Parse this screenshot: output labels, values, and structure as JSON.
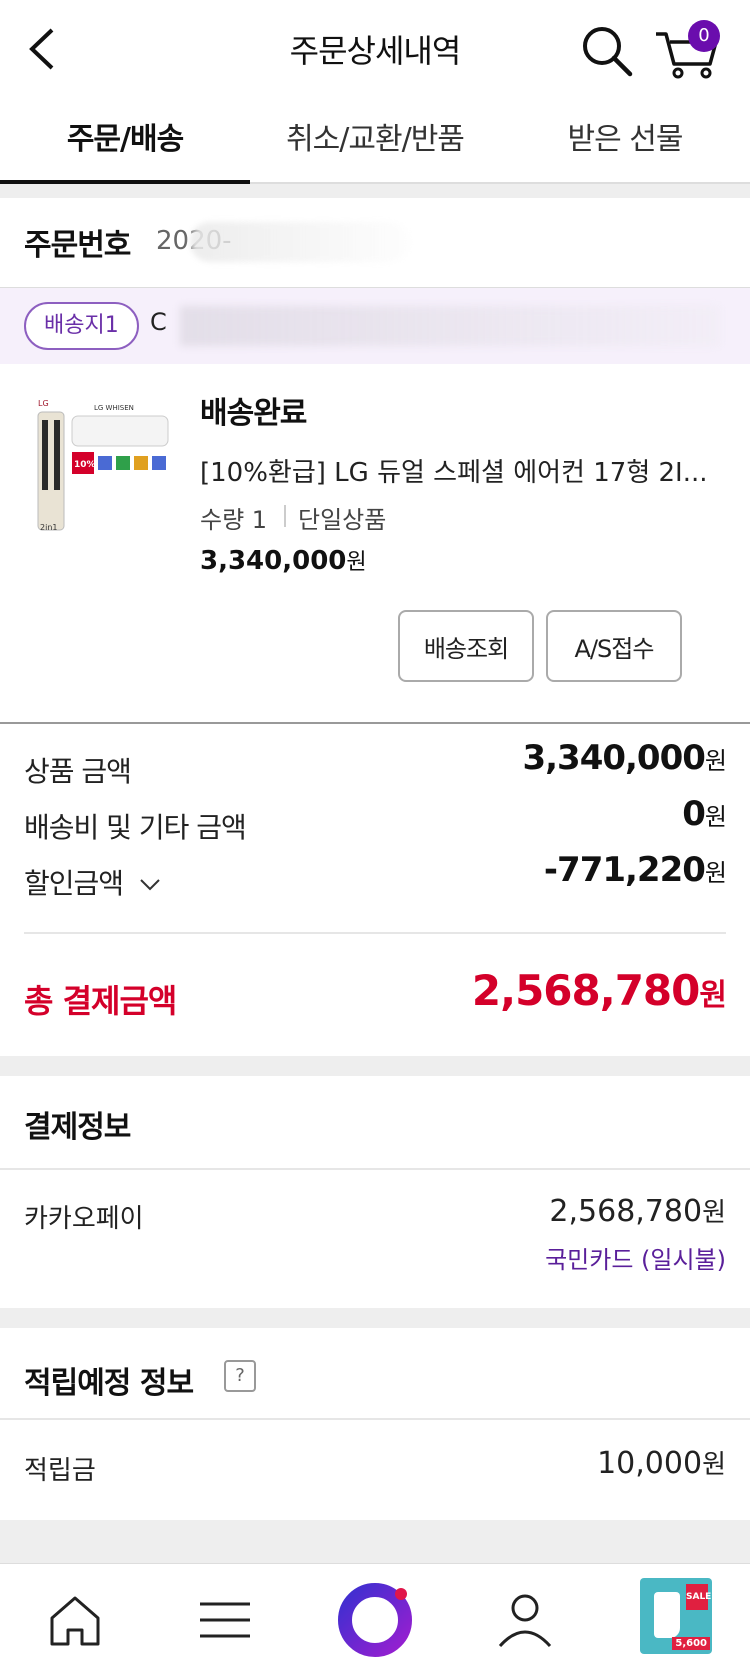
{
  "header": {
    "title": "주문상세내역",
    "cart_count": "0"
  },
  "tabs": [
    {
      "label": "주문/배송"
    },
    {
      "label": "취소/교환/반품"
    },
    {
      "label": "받은 선물"
    }
  ],
  "order": {
    "label": "주문번호",
    "number": "2020-"
  },
  "address": {
    "badge": "배송지1",
    "text": "C"
  },
  "product": {
    "status": "배송완료",
    "name": "[10%환급] LG 듀얼 스페셜 에어컨 17형 2I...",
    "quantity": "수량 1",
    "type": "단일상품",
    "price": "3,340,000",
    "price_unit": "원",
    "thumb_badge": "10%",
    "thumb_brand": "LG WHISEN",
    "thumb_label": "2in1",
    "btn_tracking": "배송조회",
    "btn_as": "A/S접수"
  },
  "amounts": {
    "product_label": "상품 금액",
    "product_value": "3,340,000",
    "shipping_label": "배송비 및 기타 금액",
    "shipping_value": "0",
    "discount_label": "할인금액",
    "discount_value": "-771,220",
    "unit": "원",
    "total_label": "총 결제금액",
    "total_value": "2,568,780"
  },
  "payment": {
    "title": "결제정보",
    "method": "카카오페이",
    "amount": "2,568,780",
    "unit": "원",
    "card": "국민카드 (일시불)"
  },
  "points": {
    "title": "적립예정 정보",
    "help": "?",
    "label": "적립금",
    "value": "10,000",
    "unit": "원"
  },
  "bottom_nav": {
    "items": [
      "home-icon",
      "menu-icon",
      "brand-logo-icon",
      "user-icon",
      "promo-thumbnail"
    ],
    "promo_sale": "SALE",
    "promo_price": "5,600"
  },
  "colors": {
    "accent": "#6a0dad",
    "total": "#d4002a",
    "card": "#5a1f9a",
    "addr_bg": "#f6f0fb"
  }
}
